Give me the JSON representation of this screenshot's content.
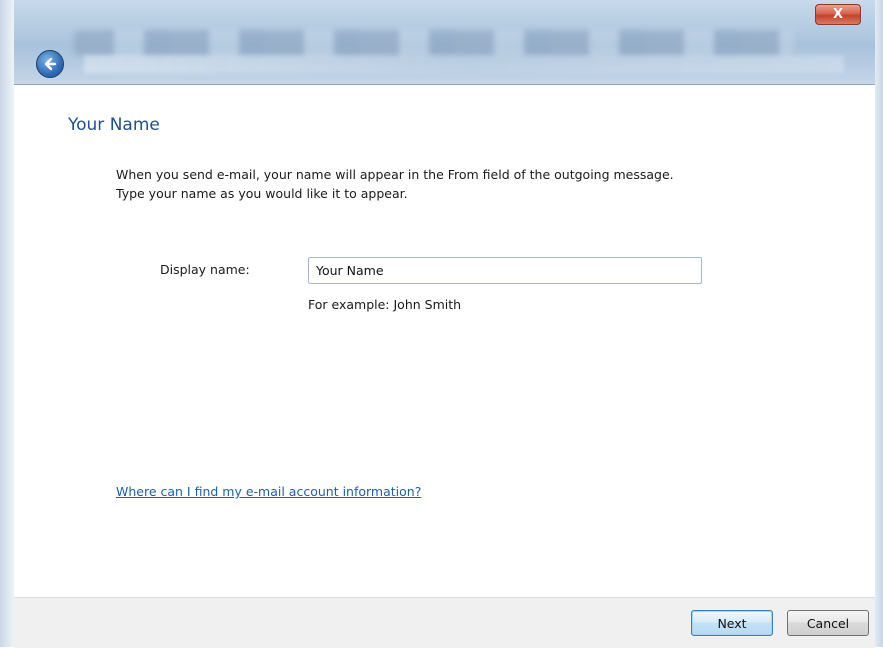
{
  "window": {
    "close_glyph": "X",
    "back_icon": "back-arrow-icon"
  },
  "page": {
    "heading": "Your Name",
    "description_line1": "When you send e-mail, your name will appear in the From field of the outgoing message.",
    "description_line2": "Type your name as you would like it to appear.",
    "display_name_label": "Display name:",
    "display_name_value": "Your Name",
    "example_text": "For example: John Smith",
    "help_link": "Where can I find my e-mail account information?"
  },
  "footer": {
    "next_label": "Next",
    "cancel_label": "Cancel"
  },
  "colors": {
    "heading": "#1f4f8f",
    "link": "#1c5fae",
    "close_button": "#c4412a"
  }
}
